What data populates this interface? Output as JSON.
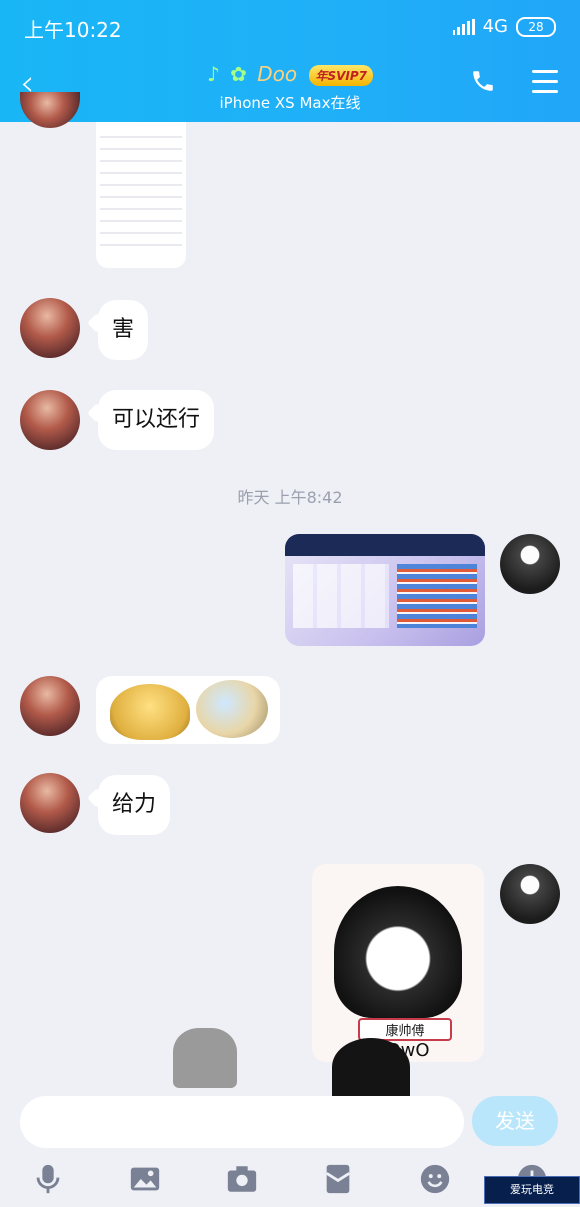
{
  "status_bar": {
    "time": "上午10:22",
    "network": "4G",
    "battery": "28"
  },
  "header": {
    "contact_name": "Doo",
    "badge": "年SVIP7",
    "subtitle": "iPhone XS Max在线"
  },
  "messages": [
    {
      "side": "left",
      "type": "text",
      "text": "害"
    },
    {
      "side": "left",
      "type": "text",
      "text": "可以还行"
    },
    {
      "type": "time",
      "text": "昨天 上午8:42"
    },
    {
      "side": "right",
      "type": "image",
      "desc_icon": "game-stats-screenshot"
    },
    {
      "side": "left",
      "type": "sticker",
      "desc_icon": "dumpling-sticker"
    },
    {
      "side": "left",
      "type": "text",
      "text": "给力"
    },
    {
      "side": "right",
      "type": "sticker",
      "caption": "康帅傅",
      "sub_caption": "OwO"
    }
  ],
  "input": {
    "placeholder": "",
    "send_label": "发送"
  },
  "toolbar": [
    "mic-icon",
    "image-icon",
    "camera-icon",
    "red-packet-icon",
    "emoji-icon",
    "more-icon"
  ],
  "watermark": "爱玩电竞",
  "colors": {
    "header": "#1fb0f8",
    "bg": "#eef0f6",
    "send": "#b9e6fa"
  }
}
